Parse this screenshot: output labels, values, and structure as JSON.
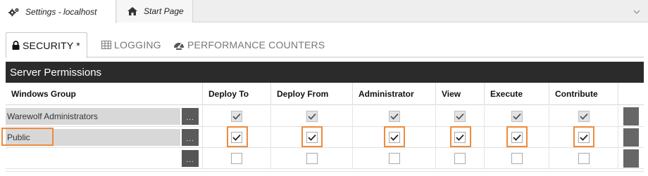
{
  "doc_tabs": [
    {
      "label": "Settings - localhost",
      "icon": "settings-gears-icon",
      "active": true
    },
    {
      "label": "Start Page",
      "icon": "home-icon",
      "active": false
    }
  ],
  "settings_tabs": [
    {
      "label": "SECURITY *",
      "icon": "lock-icon",
      "active": true
    },
    {
      "label": "LOGGING",
      "icon": "table-icon",
      "active": false
    },
    {
      "label": "PERFORMANCE COUNTERS",
      "icon": "dashboard-icon",
      "active": false
    }
  ],
  "panel": {
    "title": "Server Permissions"
  },
  "columns": [
    "Windows Group",
    "Deploy To",
    "Deploy From",
    "Administrator",
    "View",
    "Execute",
    "Contribute"
  ],
  "rows": [
    {
      "group": "Warewolf Administrators",
      "picker": "...",
      "perms": [
        true,
        true,
        true,
        true,
        true,
        true
      ],
      "disabled": true,
      "highlight": false
    },
    {
      "group": "Public",
      "picker": "...",
      "perms": [
        true,
        true,
        true,
        true,
        true,
        true
      ],
      "disabled": false,
      "highlight": true
    },
    {
      "group": "",
      "picker": "...",
      "perms": [
        false,
        false,
        false,
        false,
        false,
        false
      ],
      "disabled": false,
      "highlight": false
    }
  ],
  "colors": {
    "header_bg": "#2b2b2b",
    "highlight": "#f08a3a",
    "row_grey": "#d8d8d8"
  }
}
